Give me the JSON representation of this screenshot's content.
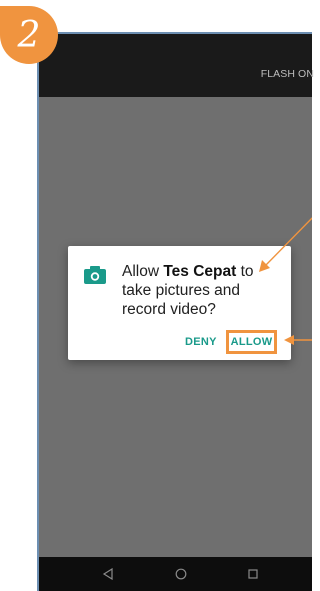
{
  "step": {
    "number": "2"
  },
  "topbar": {
    "flash_label": "FLASH ON"
  },
  "dialog": {
    "icon": "camera-icon",
    "message_prefix": "Allow ",
    "app_name": "Tes Cepat",
    "message_suffix": " to take pictures and record video?",
    "deny_label": "DENY",
    "allow_label": "ALLOW"
  },
  "navbar": {
    "icons": [
      "back-triangle-icon",
      "home-circle-icon",
      "recent-square-icon"
    ]
  },
  "colors": {
    "accent_orange": "#f0943f",
    "teal": "#1a9a8a",
    "scrim": "#6f6f6f"
  }
}
